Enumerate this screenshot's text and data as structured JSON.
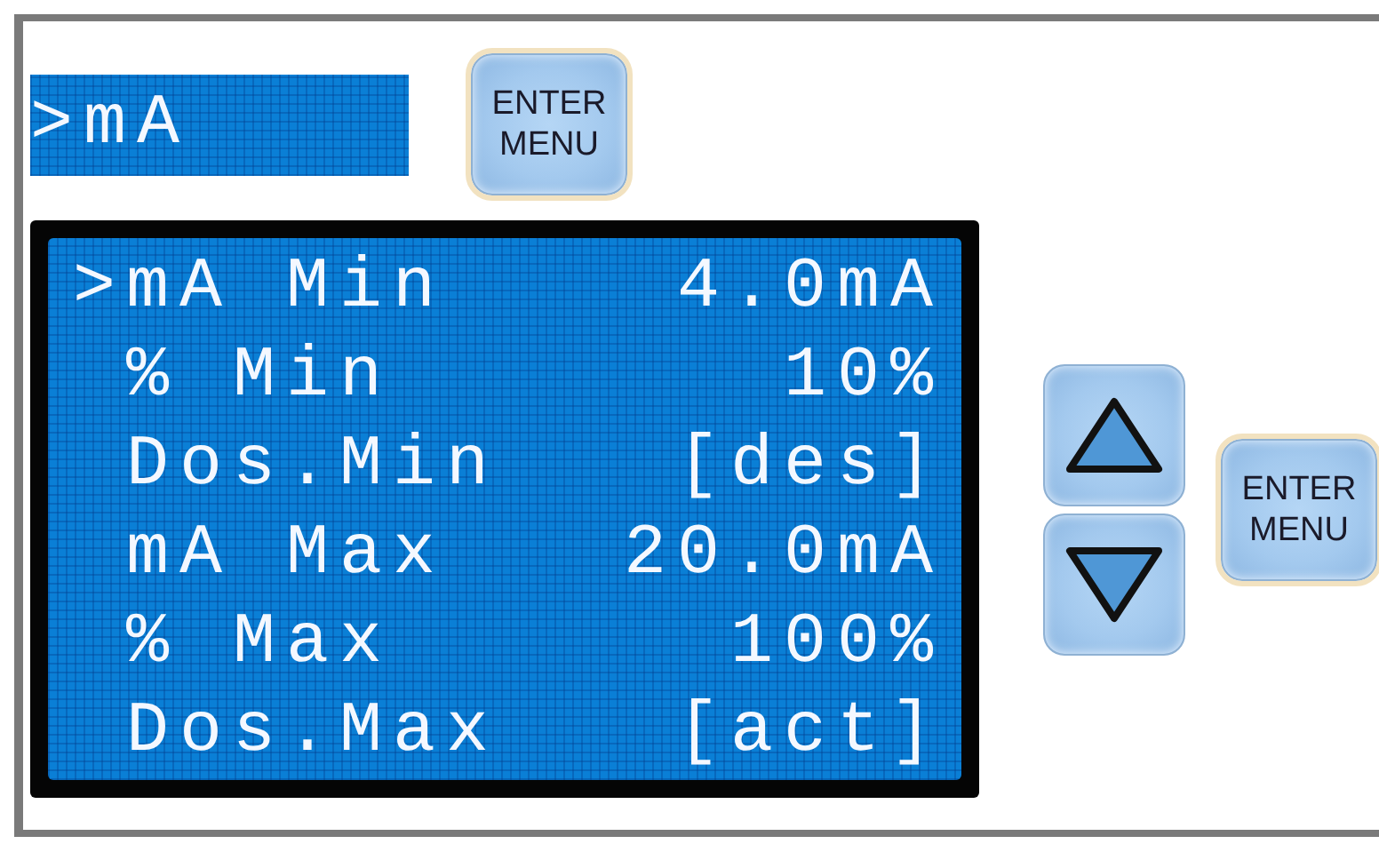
{
  "header_display": {
    "marker": ">",
    "text": "mA"
  },
  "header_button": {
    "label": "ENTER MENU"
  },
  "menu_display": {
    "rows": [
      {
        "marker": ">",
        "label": "mA Min",
        "value": "4.0mA"
      },
      {
        "marker": "",
        "label": "% Min",
        "value": "10%"
      },
      {
        "marker": "",
        "label": "Dos.Min",
        "value": "[des]"
      },
      {
        "marker": "",
        "label": "mA Max",
        "value": "20.0mA"
      },
      {
        "marker": "",
        "label": "% Max",
        "value": "100%"
      },
      {
        "marker": "",
        "label": "Dos.Max",
        "value": "[act]"
      }
    ]
  },
  "side_buttons": [
    {
      "kind": "up"
    },
    {
      "kind": "down"
    },
    {
      "kind": "enter",
      "label": "ENTER MENU"
    }
  ]
}
